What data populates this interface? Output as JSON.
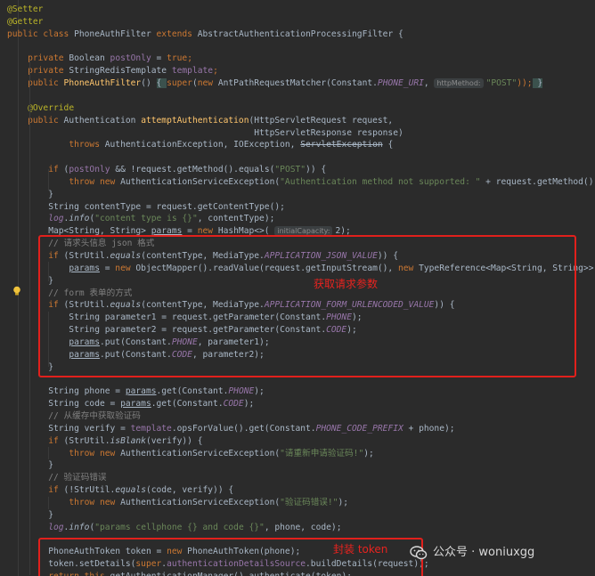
{
  "editor": {
    "lines": [
      [
        {
          "t": "@Setter",
          "c": "ann"
        }
      ],
      [
        {
          "t": "@Getter",
          "c": "ann"
        }
      ],
      [
        {
          "t": "public class ",
          "c": "kw"
        },
        {
          "t": "PhoneAuthFilter "
        },
        {
          "t": "extends ",
          "c": "kw"
        },
        {
          "t": "AbstractAuthenticationProcessingFilter {"
        }
      ],
      [],
      [
        {
          "t": "    "
        },
        {
          "t": "private ",
          "c": "kw"
        },
        {
          "t": "Boolean "
        },
        {
          "t": "postOnly",
          "c": "fld"
        },
        {
          "t": " = "
        },
        {
          "t": "true",
          "c": "kw"
        },
        {
          "t": ";",
          "c": "kw"
        }
      ],
      [
        {
          "t": "    "
        },
        {
          "t": "private ",
          "c": "kw"
        },
        {
          "t": "StringRedisTemplate "
        },
        {
          "t": "template",
          "c": "fld"
        },
        {
          "t": ";",
          "c": "kw"
        }
      ],
      [
        {
          "t": "    "
        },
        {
          "t": "public ",
          "c": "kw"
        },
        {
          "t": "PhoneAuthFilter",
          "c": "fn"
        },
        {
          "t": "() "
        },
        {
          "t": "{ ",
          "c": "brace-hl"
        },
        {
          "t": "super",
          "c": "kw"
        },
        {
          "t": "("
        },
        {
          "t": "new ",
          "c": "kw"
        },
        {
          "t": "AntPathRequestMatcher(Constant."
        },
        {
          "t": "PHONE_URI",
          "c": "sfld"
        },
        {
          "t": ", "
        },
        {
          "t": "httpMethod:",
          "c": "hint"
        },
        {
          "t": "\"POST\"",
          "c": "str"
        },
        {
          "t": "));",
          "c": "kw"
        },
        {
          "t": " }",
          "c": "brace-hl"
        }
      ],
      [],
      [
        {
          "t": "    "
        },
        {
          "t": "@Override",
          "c": "ann"
        }
      ],
      [
        {
          "t": "    "
        },
        {
          "t": "public ",
          "c": "kw"
        },
        {
          "t": "Authentication "
        },
        {
          "t": "attemptAuthentication",
          "c": "fn"
        },
        {
          "t": "(HttpServletRequest request,"
        }
      ],
      [
        {
          "t": "                                                HttpServletResponse response)"
        }
      ],
      [
        {
          "t": "            "
        },
        {
          "t": "throws ",
          "c": "kw"
        },
        {
          "t": "AuthenticationException, IOException, "
        },
        {
          "t": "ServletException",
          "c": "strike"
        },
        {
          "t": " {"
        }
      ],
      [],
      [
        {
          "t": "        "
        },
        {
          "t": "if ",
          "c": "kw"
        },
        {
          "t": "("
        },
        {
          "t": "postOnly",
          "c": "fld"
        },
        {
          "t": " && !request.getMethod().equals("
        },
        {
          "t": "\"POST\"",
          "c": "str"
        },
        {
          "t": ")) {"
        }
      ],
      [
        {
          "t": "            "
        },
        {
          "t": "throw new ",
          "c": "kw"
        },
        {
          "t": "AuthenticationServiceException("
        },
        {
          "t": "\"Authentication method not supported: \"",
          "c": "str"
        },
        {
          "t": " + request.getMethod());"
        }
      ],
      [
        {
          "t": "        }"
        }
      ],
      [
        {
          "t": "        String contentType = request.getContentType();"
        }
      ],
      [
        {
          "t": "        "
        },
        {
          "t": "log",
          "c": "sfld"
        },
        {
          "t": "."
        },
        {
          "t": "info",
          "c": "fi"
        },
        {
          "t": "("
        },
        {
          "t": "\"content type is {}\"",
          "c": "str"
        },
        {
          "t": ", contentType);"
        }
      ],
      [
        {
          "t": "        Map<String, String> "
        },
        {
          "t": "params",
          "c": "ul"
        },
        {
          "t": " = "
        },
        {
          "t": "new ",
          "c": "kw"
        },
        {
          "t": "HashMap<>( "
        },
        {
          "t": "initialCapacity:",
          "c": "hint"
        },
        {
          "t": "2);"
        }
      ],
      [
        {
          "t": "        "
        },
        {
          "t": "// 请求头信息 json 格式",
          "c": "cmt"
        }
      ],
      [
        {
          "t": "        "
        },
        {
          "t": "if ",
          "c": "kw"
        },
        {
          "t": "(StrUtil."
        },
        {
          "t": "equals",
          "c": "fi"
        },
        {
          "t": "(contentType, MediaType."
        },
        {
          "t": "APPLICATION_JSON_VALUE",
          "c": "sfld"
        },
        {
          "t": ")) {"
        }
      ],
      [
        {
          "t": "            "
        },
        {
          "t": "params",
          "c": "ul"
        },
        {
          "t": " = "
        },
        {
          "t": "new ",
          "c": "kw"
        },
        {
          "t": "ObjectMapper().readValue(request.getInputStream(), "
        },
        {
          "t": "new ",
          "c": "kw"
        },
        {
          "t": "TypeReference<Map<String, String>>() "
        },
        {
          "t": "{});",
          "c": "cn"
        }
      ],
      [
        {
          "t": "        }"
        }
      ],
      [
        {
          "t": "        "
        },
        {
          "t": "// form 表单的方式",
          "c": "cmt"
        }
      ],
      [
        {
          "t": "        "
        },
        {
          "t": "if ",
          "c": "kw"
        },
        {
          "t": "(StrUtil."
        },
        {
          "t": "equals",
          "c": "fi"
        },
        {
          "t": "(contentType, MediaType."
        },
        {
          "t": "APPLICATION_FORM_URLENCODED_VALUE",
          "c": "sfld"
        },
        {
          "t": ")) {"
        }
      ],
      [
        {
          "t": "            String parameter1 = request.getParameter(Constant."
        },
        {
          "t": "PHONE",
          "c": "sfld"
        },
        {
          "t": ");"
        }
      ],
      [
        {
          "t": "            String parameter2 = request.getParameter(Constant."
        },
        {
          "t": "CODE",
          "c": "sfld"
        },
        {
          "t": ");"
        }
      ],
      [
        {
          "t": "            "
        },
        {
          "t": "params",
          "c": "ul"
        },
        {
          "t": ".put(Constant."
        },
        {
          "t": "PHONE",
          "c": "sfld"
        },
        {
          "t": ", parameter1);"
        }
      ],
      [
        {
          "t": "            "
        },
        {
          "t": "params",
          "c": "ul"
        },
        {
          "t": ".put(Constant."
        },
        {
          "t": "CODE",
          "c": "sfld"
        },
        {
          "t": ", parameter2);"
        }
      ],
      [
        {
          "t": "        }"
        }
      ],
      [],
      [
        {
          "t": "        String phone = "
        },
        {
          "t": "params",
          "c": "ul"
        },
        {
          "t": ".get(Constant."
        },
        {
          "t": "PHONE",
          "c": "sfld"
        },
        {
          "t": ");"
        }
      ],
      [
        {
          "t": "        String code = "
        },
        {
          "t": "params",
          "c": "ul"
        },
        {
          "t": ".get(Constant."
        },
        {
          "t": "CODE",
          "c": "sfld"
        },
        {
          "t": ");"
        }
      ],
      [
        {
          "t": "        "
        },
        {
          "t": "// 从缓存中获取验证码",
          "c": "cmt"
        }
      ],
      [
        {
          "t": "        String verify = "
        },
        {
          "t": "template",
          "c": "fld"
        },
        {
          "t": ".opsForValue().get(Constant."
        },
        {
          "t": "PHONE_CODE_PREFIX",
          "c": "sfld"
        },
        {
          "t": " + phone);"
        }
      ],
      [
        {
          "t": "        "
        },
        {
          "t": "if ",
          "c": "kw"
        },
        {
          "t": "(StrUtil."
        },
        {
          "t": "isBlank",
          "c": "fi"
        },
        {
          "t": "(verify)) {"
        }
      ],
      [
        {
          "t": "            "
        },
        {
          "t": "throw new ",
          "c": "kw"
        },
        {
          "t": "AuthenticationServiceException("
        },
        {
          "t": "\"请重新申请验证码!\"",
          "c": "str"
        },
        {
          "t": ");"
        }
      ],
      [
        {
          "t": "        }"
        }
      ],
      [
        {
          "t": "        "
        },
        {
          "t": "// 验证码错误",
          "c": "cmt"
        }
      ],
      [
        {
          "t": "        "
        },
        {
          "t": "if ",
          "c": "kw"
        },
        {
          "t": "(!StrUtil."
        },
        {
          "t": "equals",
          "c": "fi"
        },
        {
          "t": "(code, verify)) {"
        }
      ],
      [
        {
          "t": "            "
        },
        {
          "t": "throw new ",
          "c": "kw"
        },
        {
          "t": "AuthenticationServiceException("
        },
        {
          "t": "\"验证码错误!\"",
          "c": "str"
        },
        {
          "t": ");"
        }
      ],
      [
        {
          "t": "        }"
        }
      ],
      [
        {
          "t": "        "
        },
        {
          "t": "log",
          "c": "sfld"
        },
        {
          "t": "."
        },
        {
          "t": "info",
          "c": "fi"
        },
        {
          "t": "("
        },
        {
          "t": "\"params cellphone {} and code {}\"",
          "c": "str"
        },
        {
          "t": ", phone, code);"
        }
      ],
      [],
      [
        {
          "t": "        PhoneAuthToken token = "
        },
        {
          "t": "new ",
          "c": "kw"
        },
        {
          "t": "PhoneAuthToken(phone);"
        }
      ],
      [
        {
          "t": "        token.setDetails("
        },
        {
          "t": "super",
          "c": "kw"
        },
        {
          "t": "."
        },
        {
          "t": "authenticationDetailsSource",
          "c": "fld"
        },
        {
          "t": ".buildDetails(request));"
        }
      ],
      [
        {
          "t": "        "
        },
        {
          "t": "return this",
          "c": "kw"
        },
        {
          "t": ".getAuthenticationManager().authenticate(token);"
        }
      ]
    ]
  },
  "annotations": {
    "get_params_label": "获取请求参数",
    "wrap_token_label": "封装 token"
  },
  "watermark": {
    "text": "公众号 · woniuxgg"
  },
  "colors": {
    "background": "#2b2b2b",
    "highlight_border": "#e1201c",
    "label_text": "#e8231f"
  }
}
